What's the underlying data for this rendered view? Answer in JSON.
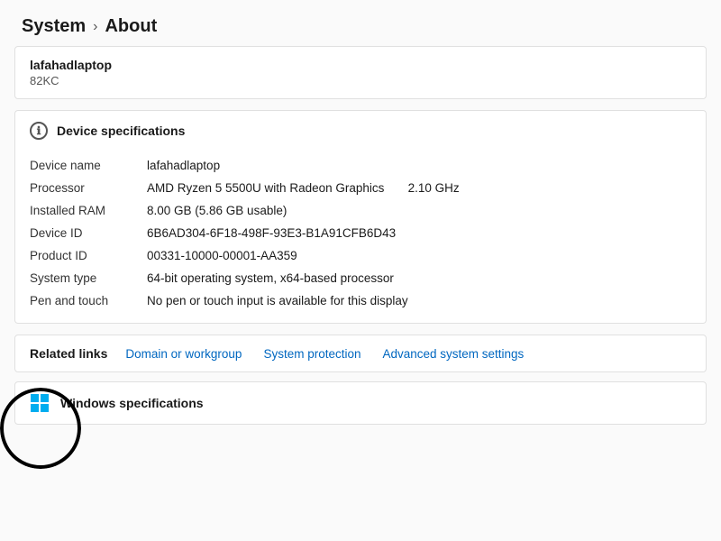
{
  "breadcrumb": {
    "system": "System",
    "chevron": "›",
    "about": "About"
  },
  "device_header": {
    "name": "lafahadlaptop",
    "model": "82KC"
  },
  "device_specs_section": {
    "icon": "ℹ",
    "title": "Device specifications"
  },
  "specs": [
    {
      "label": "Device name",
      "value": "lafahadlaptop",
      "extra": ""
    },
    {
      "label": "Processor",
      "value": "AMD Ryzen 5 5500U with Radeon Graphics",
      "extra": "2.10 GHz"
    },
    {
      "label": "Installed RAM",
      "value": "8.00 GB (5.86 GB usable)",
      "extra": ""
    },
    {
      "label": "Device ID",
      "value": "6B6AD304-6F18-498F-93E3-B1A91CFB6D43",
      "extra": ""
    },
    {
      "label": "Product ID",
      "value": "00331-10000-00001-AA359",
      "extra": ""
    },
    {
      "label": "System type",
      "value": "64-bit operating system, x64-based processor",
      "extra": ""
    },
    {
      "label": "Pen and touch",
      "value": "No pen or touch input is available for this display",
      "extra": ""
    }
  ],
  "related_links": {
    "label": "Related links",
    "links": [
      "Domain or workgroup",
      "System protection",
      "Advanced system settings"
    ]
  },
  "windows_specs": {
    "label": "Windows specifications"
  }
}
